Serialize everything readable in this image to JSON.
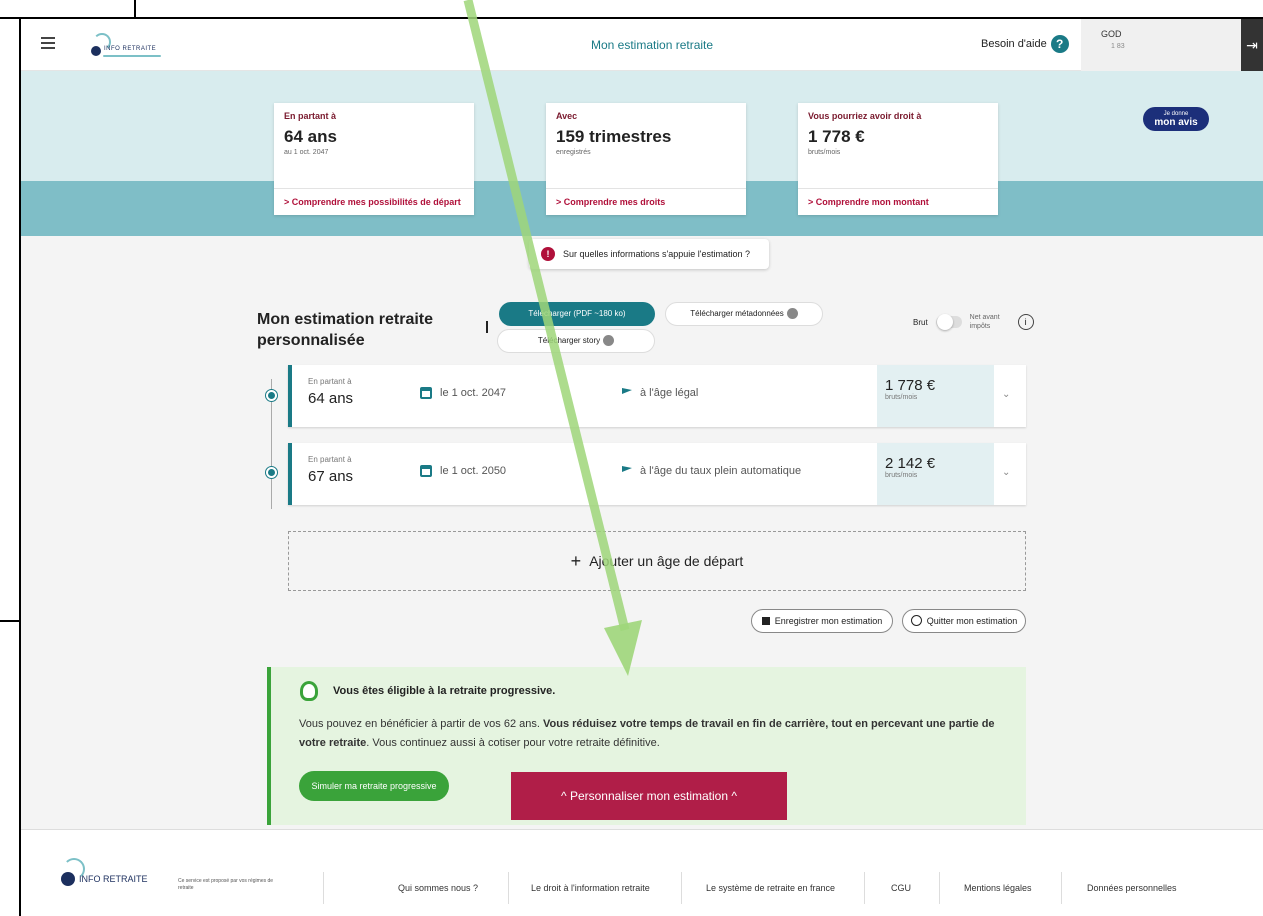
{
  "header": {
    "title": "Mon estimation retraite",
    "logo_text": "INFO RETRAITE",
    "help_label": "Besoin d'aide",
    "help_icon": "?",
    "user_name": "GOD",
    "user_sub": "1 83"
  },
  "cards": [
    {
      "label": "En partant à",
      "value": "64 ans",
      "sub": "au 1 oct. 2047",
      "link": "> Comprendre mes possibilités de départ"
    },
    {
      "label": "Avec",
      "value": "159 trimestres",
      "sub": "enregistrés",
      "link": "> Comprendre mes droits"
    },
    {
      "label": "Vous pourriez avoir droit à",
      "value": "1 778 €",
      "sub": "bruts/mois",
      "link": "> Comprendre mon montant"
    }
  ],
  "feedback": {
    "line1": "Je donne",
    "line2": "mon avis"
  },
  "info_pill": "Sur quelles informations s'appuie l'estimation ?",
  "estimation": {
    "title": "Mon estimation retraite personnalisée",
    "download_pdf": "Télécharger (PDF ~180 ko)",
    "download_meta": "Télécharger métadonnées",
    "download_story": "Télécharger story",
    "toggle_left": "Brut",
    "toggle_right": "Net avant impôts"
  },
  "rows": [
    {
      "age_label": "En partant à",
      "age": "64 ans",
      "date": "le 1 oct. 2047",
      "condition": "à l'âge légal",
      "amount": "1 778 €",
      "amount_sub": "bruts/mois"
    },
    {
      "age_label": "En partant à",
      "age": "67 ans",
      "date": "le 1 oct. 2050",
      "condition": "à l'âge du taux plein automatique",
      "amount": "2 142 €",
      "amount_sub": "bruts/mois"
    }
  ],
  "add_age": "Ajouter un âge de départ",
  "save_label": "Enregistrer mon estimation",
  "quit_label": "Quitter mon estimation",
  "progressive": {
    "title": "Vous êtes éligible à la retraite progressive.",
    "text_a": "Vous pouvez en bénéficier à partir de vos 62 ans. ",
    "text_b": "Vous réduisez votre temps de travail en fin de carrière, tout en percevant une partie de votre retraite",
    "text_c": ". Vous continuez aussi à cotiser pour votre retraite définitive.",
    "button": "Simuler ma retraite progressive"
  },
  "personalize": "^   Personnaliser mon estimation   ^",
  "footer": {
    "logo_text": "INFO RETRAITE",
    "note": "Ce service est proposé par vos régimes de retraite",
    "links": [
      "Qui sommes nous ?",
      "Le droit à l'information retraite",
      "Le système de retraite en france",
      "CGU",
      "Mentions légales",
      "Données personnelles"
    ]
  },
  "colors": {
    "teal": "#1a7a86",
    "crimson": "#b0103a",
    "green": "#3aa33a",
    "arrow": "#9fd67a"
  }
}
